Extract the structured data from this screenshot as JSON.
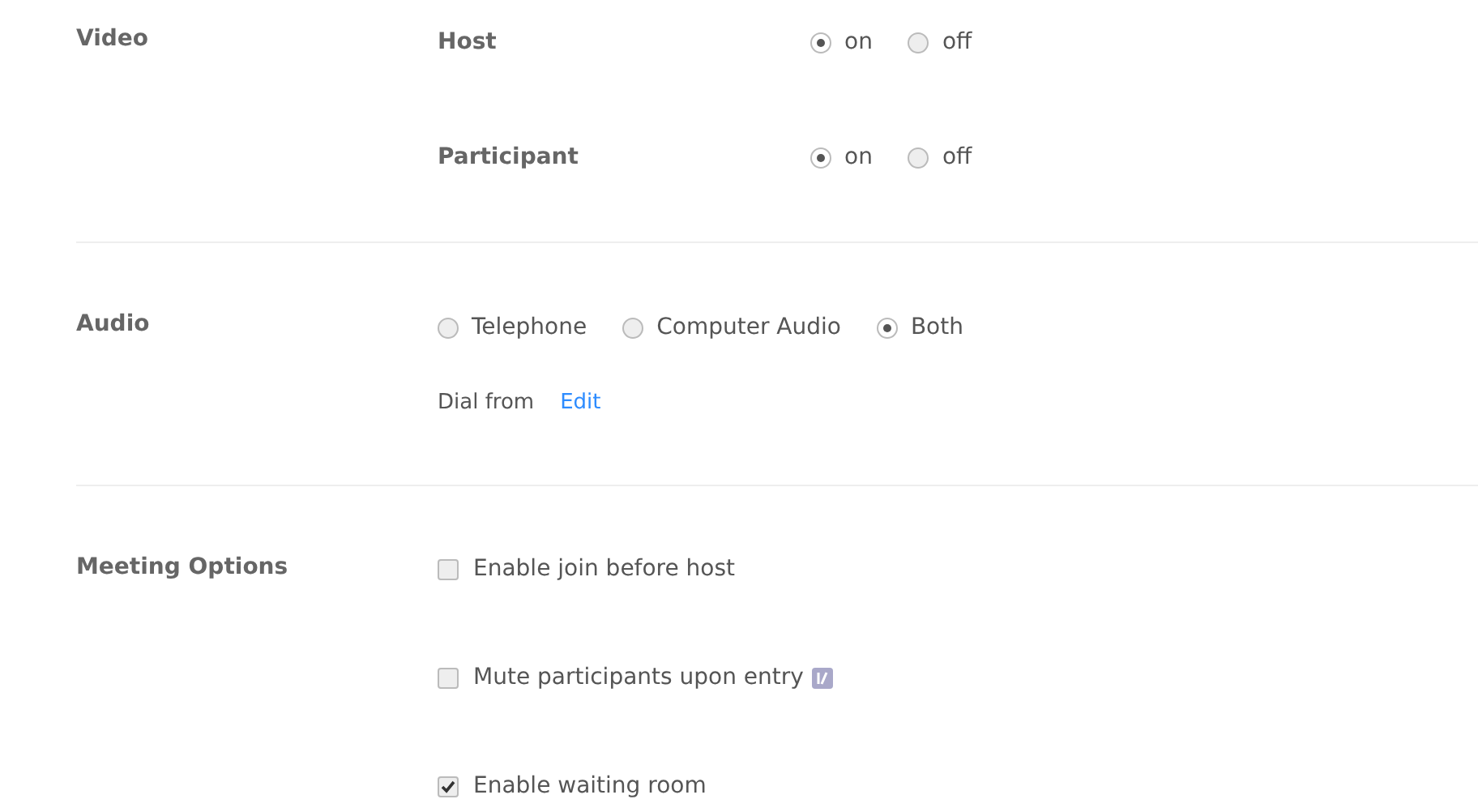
{
  "sections": [
    {
      "title": "Video",
      "kind": "video",
      "rows": [
        {
          "label": "Host",
          "options": [
            {
              "label": "on",
              "selected": true
            },
            {
              "label": "off",
              "selected": false
            }
          ]
        },
        {
          "label": "Participant",
          "options": [
            {
              "label": "on",
              "selected": true
            },
            {
              "label": "off",
              "selected": false
            }
          ]
        }
      ]
    },
    {
      "title": "Audio",
      "kind": "audio",
      "options": [
        {
          "label": "Telephone",
          "selected": false
        },
        {
          "label": "Computer Audio",
          "selected": false
        },
        {
          "label": "Both",
          "selected": true
        }
      ],
      "dial_from": {
        "label": "Dial from",
        "link": "Edit"
      }
    },
    {
      "title": "Meeting Options",
      "kind": "options",
      "checkboxes": [
        {
          "label": "Enable join before host",
          "checked": false,
          "badge": false
        },
        {
          "label": "Mute participants upon entry",
          "checked": false,
          "badge": true
        },
        {
          "label": "Enable waiting room",
          "checked": true,
          "badge": false
        }
      ]
    }
  ]
}
